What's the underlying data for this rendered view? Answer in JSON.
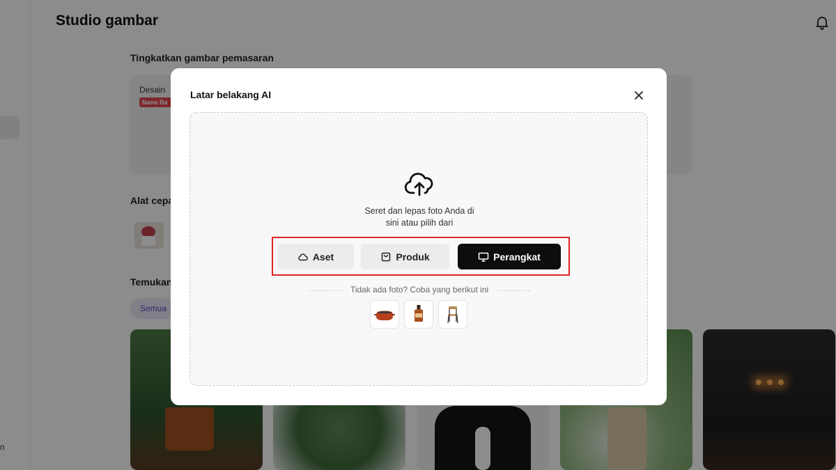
{
  "app": {
    "title": "Studio gambar"
  },
  "sections": {
    "upgrade_title": "Tingkatkan gambar pemasaran",
    "quick_tools_title": "Alat cepa",
    "discover_title": "Temukan"
  },
  "promo_card": {
    "title": "Desain",
    "badge": "Nano Ba"
  },
  "filter_chip": {
    "label": "Semua"
  },
  "sidebar": {
    "letter": "n"
  },
  "modal": {
    "title": "Latar belakang AI",
    "drop_text_line1": "Seret dan lepas foto Anda di",
    "drop_text_line2": "sini atau pilih dari",
    "buttons": {
      "aset": "Aset",
      "produk": "Produk",
      "perangkat": "Perangkat"
    },
    "sample_label": "Tidak ada foto? Coba yang berikut ini",
    "samples": [
      "pot-icon",
      "bottle-icon",
      "chair-icon"
    ]
  },
  "colors": {
    "highlight": "#e02424",
    "primary_button": "#0d0d0d",
    "secondary_button": "#ececec",
    "badge": "#e5484d",
    "chip_text": "#5b3fc9"
  }
}
